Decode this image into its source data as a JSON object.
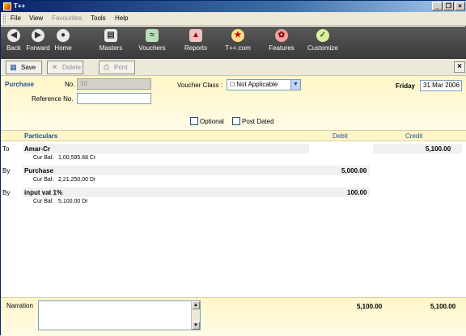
{
  "window": {
    "title": "T++"
  },
  "menu": [
    "File",
    "View",
    "Favourites",
    "Tools",
    "Help"
  ],
  "toolbar": {
    "back": "Back",
    "forward": "Forward",
    "home": "Home",
    "masters": "Masters",
    "vouchers": "Vouchers",
    "reports": "Reports",
    "tpp": "T++.com",
    "features": "Features",
    "customize": "Customize"
  },
  "actions": {
    "save": "Save",
    "delete": "Delete",
    "print": "Print"
  },
  "header": {
    "voucher_type": "Purchase",
    "no_label": "No.",
    "no_value": "10",
    "ref_label": "Reference No.",
    "ref_value": "",
    "voucher_class_label": "Voucher Class :",
    "voucher_class_value": "Not Applicable",
    "day": "Friday",
    "date": "31 Mar 2006",
    "optional_label": "Optional",
    "post_dated_label": "Post Dated"
  },
  "grid": {
    "headers": {
      "particulars": "Particulars",
      "debit": "Debit",
      "credit": "Credit"
    },
    "rows": [
      {
        "prefix": "To",
        "name": "Amar-Cr",
        "debit": "",
        "credit": "5,100.00",
        "bal_label": "Cur Bal:",
        "bal": "1,00,595.68 Cr"
      },
      {
        "prefix": "By",
        "name": "Purchase",
        "debit": "5,000.00",
        "credit": "",
        "bal_label": "Cur Bal:",
        "bal": "2,21,250.00 Dr"
      },
      {
        "prefix": "By",
        "name": "input vat 1%",
        "debit": "100.00",
        "credit": "",
        "bal_label": "Cur Bal:",
        "bal": "5,100.00 Dr"
      }
    ]
  },
  "footer": {
    "narration_label": "Narration",
    "narration_value": "",
    "total_debit": "5,100.00",
    "total_credit": "5,100.00"
  }
}
